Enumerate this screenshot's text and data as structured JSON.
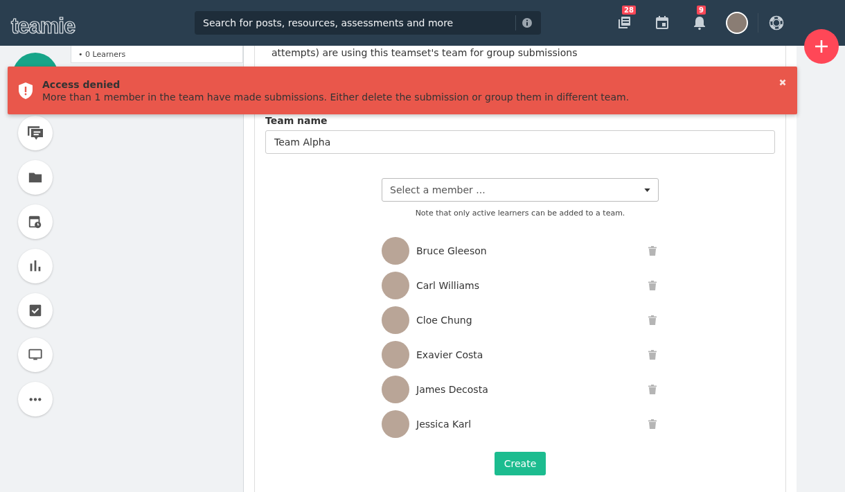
{
  "header": {
    "logo": "teamie",
    "search": {
      "placeholder": "Search for posts, resources, assessments and more"
    },
    "icons": [
      {
        "kind": "posts",
        "badge": "28"
      },
      {
        "kind": "calendar"
      },
      {
        "kind": "bell",
        "badge": "9"
      }
    ]
  },
  "side_card": {
    "text": "• 0 Learners"
  },
  "rail": [
    {
      "kind": "chat"
    },
    {
      "kind": "folder"
    },
    {
      "kind": "schedule"
    },
    {
      "kind": "chart"
    },
    {
      "kind": "checkbox"
    },
    {
      "kind": "monitor"
    },
    {
      "kind": "more"
    }
  ],
  "intro": "attempts) are using this teamset's team for group submissions",
  "alert": {
    "title": "Access denied",
    "message": "More than 1 member in the team have made submissions. Either delete the submission or group them in different team."
  },
  "form": {
    "label": "Team name",
    "value": "Team Alpha",
    "member_select": {
      "placeholder": "Select a member ..."
    },
    "note": "Note that only active learners can be added to a team."
  },
  "members": [
    {
      "name": "Bruce Gleeson"
    },
    {
      "name": "Carl Williams"
    },
    {
      "name": "Cloe Chung"
    },
    {
      "name": "Exavier Costa"
    },
    {
      "name": "James Decosta"
    },
    {
      "name": "Jessica Karl"
    }
  ],
  "submit": "Create"
}
